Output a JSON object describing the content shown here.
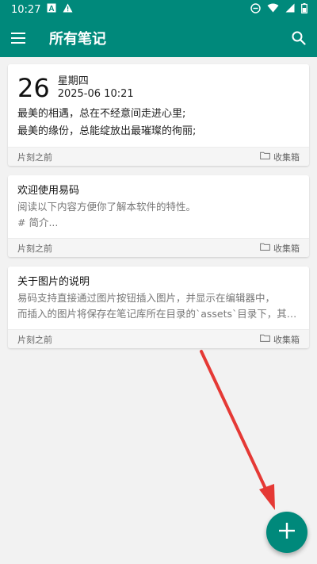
{
  "status_bar": {
    "time": "10:27"
  },
  "app_bar": {
    "title": "所有笔记"
  },
  "diary_card": {
    "day": "26",
    "weekday": "星期四",
    "datetime": "2025-06  10:21",
    "lines": [
      "最美的相遇，总在不经意间走进心里;",
      "最美的缘份，总能绽放出最璀璨的徇丽;"
    ],
    "time_ago": "片刻之前",
    "folder": "收集箱"
  },
  "notes": [
    {
      "title": "欢迎使用易码",
      "lines": [
        "阅读以下内容方便你了解本软件的特性。",
        "# 简介..."
      ],
      "time_ago": "片刻之前",
      "folder": "收集箱"
    },
    {
      "title": "关于图片的说明",
      "lines": [
        "易码支持直接通过图片按钮插入图片，并显示在编辑器中，",
        "而插入的图片将保存在笔记库所在目录的`assets`目录下，其 M..."
      ],
      "time_ago": "片刻之前",
      "folder": "收集箱"
    }
  ],
  "colors": {
    "accent": "#00897b",
    "arrow": "#e53935"
  }
}
